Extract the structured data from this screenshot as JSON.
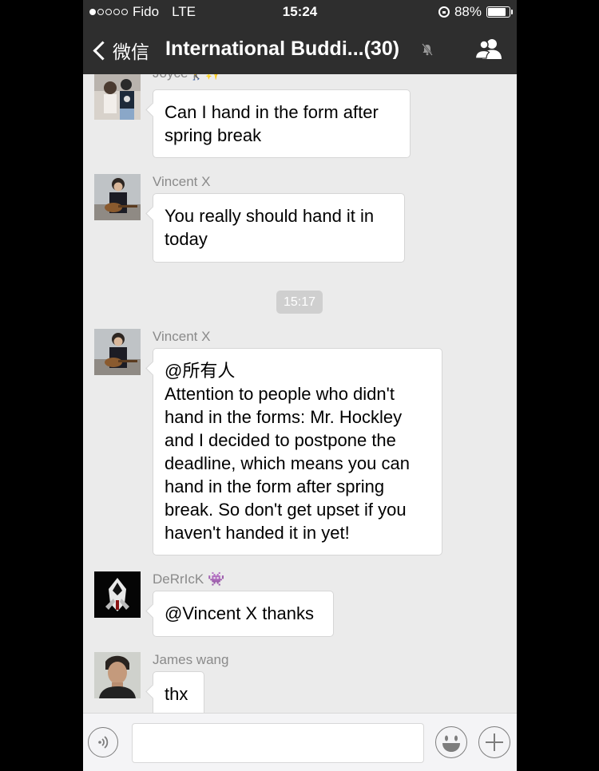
{
  "status_bar": {
    "carrier": "Fido",
    "network": "LTE",
    "time": "15:24",
    "battery": "88%",
    "battery_level": 0.88,
    "signal_bars_filled": 1,
    "signal_bars_total": 5
  },
  "nav": {
    "back_label": "微信",
    "title": "International Buddi...(30)",
    "icons": [
      "chevron-left-icon",
      "mute-bell-icon",
      "group-members-icon"
    ]
  },
  "messages": [
    {
      "sender": "Joyce🚶‍♀️✨",
      "lines": [
        "Can I hand in the form after",
        "spring break"
      ]
    },
    {
      "sender": "Vincent X",
      "lines": [
        "You really should hand it in",
        "today"
      ]
    },
    {
      "sender": "Vincent X",
      "lines": [
        "@所有人",
        "Attention to people who didn't",
        "hand in the forms: Mr. Hockley",
        "and I decided to postpone the",
        "deadline, which means you can",
        "hand in the form after spring",
        "break. So don't get upset if you",
        "haven't handed it in yet!"
      ]
    },
    {
      "sender": "DeRrIcK 👾",
      "lines": [
        "@Vincent X thanks"
      ]
    },
    {
      "sender": "James wang",
      "lines": [
        "thx"
      ]
    }
  ],
  "timestamp": "15:17",
  "input_bar": {
    "icons": [
      "voice-icon",
      "emoji-icon",
      "plus-icon"
    ],
    "input_value": ""
  },
  "colors": {
    "header_bg": "#2e2e2e",
    "chat_bg": "#ebebeb",
    "bubble_bg": "#ffffff",
    "sender_text": "#8a8a8a"
  }
}
